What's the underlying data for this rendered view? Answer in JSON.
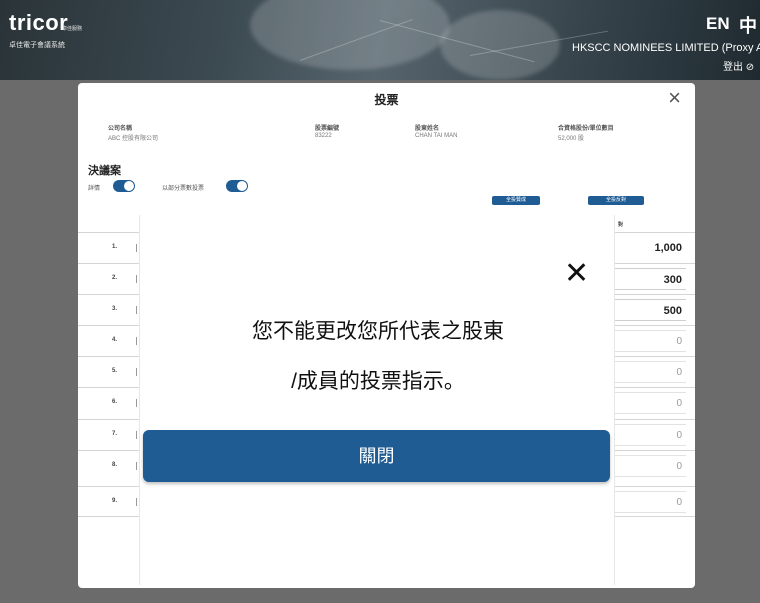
{
  "header": {
    "logo": "tricor",
    "logo_tag": "卓佳服務",
    "subtitle": "卓佳電子會議系統",
    "lang_en": "EN",
    "lang_zh": "中",
    "account": "HKSCC NOMINEES LIMITED (Proxy A)",
    "logout": "登出",
    "logout_icon": "logout-icon"
  },
  "card": {
    "title": "投票",
    "close_icon": "close-icon",
    "meta": {
      "company_label": "公司名稱",
      "company_value": "ABC 控股有限公司",
      "stock_code_label": "股票編號",
      "stock_code_value": "83222",
      "holder_label": "股東姓名",
      "holder_value": "CHAN TAI MAN",
      "shares_label": "合資格股份/單位數目",
      "shares_value": "52,000 股"
    },
    "section_title": "決議案",
    "toggle_detail_label": "詳情",
    "toggle_partial_label": "以部分票數投票",
    "all_for_label": "全投贊成",
    "all_against_label": "全投反對",
    "column_against": "對",
    "rows": [
      {
        "num": "1.",
        "value": "1,000"
      },
      {
        "num": "2.",
        "value": "300"
      },
      {
        "num": "3.",
        "value": "500"
      },
      {
        "num": "4.",
        "value": "0"
      },
      {
        "num": "5.",
        "value": "0"
      },
      {
        "num": "6.",
        "value": "0"
      },
      {
        "num": "7.",
        "value": "0"
      },
      {
        "num": "8.",
        "value": "0"
      },
      {
        "num": "9.",
        "value": "0"
      }
    ]
  },
  "dialog": {
    "close_icon": "close-icon",
    "message_line1": "您不能更改您所代表之股東",
    "message_line2": "/成員的投票指示。",
    "button_label": "關閉"
  },
  "colors": {
    "primary": "#1f5c94",
    "overlay": "#6b6b6b"
  }
}
